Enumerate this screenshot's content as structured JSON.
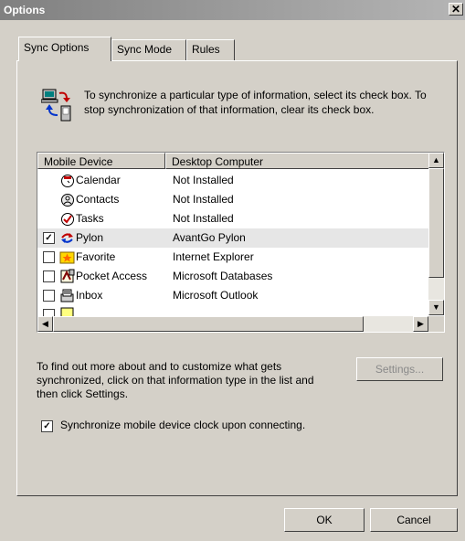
{
  "window": {
    "title": "Options"
  },
  "tabs": [
    {
      "label": "Sync Options",
      "active": true
    },
    {
      "label": "Sync Mode",
      "active": false
    },
    {
      "label": "Rules",
      "active": false
    }
  ],
  "intro_text": "To synchronize a particular type of information, select its check box. To stop synchronization of that information, clear its check box.",
  "list": {
    "columns": [
      "Mobile Device",
      "Desktop Computer"
    ],
    "rows": [
      {
        "name": "Calendar",
        "desktop": "Not Installed",
        "checkbox": false,
        "checked": false,
        "icon": "calendar-icon"
      },
      {
        "name": "Contacts",
        "desktop": "Not Installed",
        "checkbox": false,
        "checked": false,
        "icon": "contacts-icon"
      },
      {
        "name": "Tasks",
        "desktop": "Not Installed",
        "checkbox": false,
        "checked": false,
        "icon": "tasks-icon"
      },
      {
        "name": "Pylon",
        "desktop": "AvantGo Pylon",
        "checkbox": true,
        "checked": true,
        "icon": "sync-arrows-icon"
      },
      {
        "name": "Favorite",
        "desktop": "Internet Explorer",
        "checkbox": true,
        "checked": false,
        "icon": "favorite-icon"
      },
      {
        "name": "Pocket Access",
        "desktop": "Microsoft Databases",
        "checkbox": true,
        "checked": false,
        "icon": "pocket-access-icon"
      },
      {
        "name": "Inbox",
        "desktop": "Microsoft Outlook",
        "checkbox": true,
        "checked": false,
        "icon": "inbox-icon"
      }
    ]
  },
  "help_text": "To find out more about and to customize what gets synchronized, click on that information type in the list and then click Settings.",
  "buttons": {
    "settings": "Settings...",
    "ok": "OK",
    "cancel": "Cancel"
  },
  "clock_sync": {
    "label": "Synchronize mobile device clock upon connecting.",
    "checked": true
  }
}
